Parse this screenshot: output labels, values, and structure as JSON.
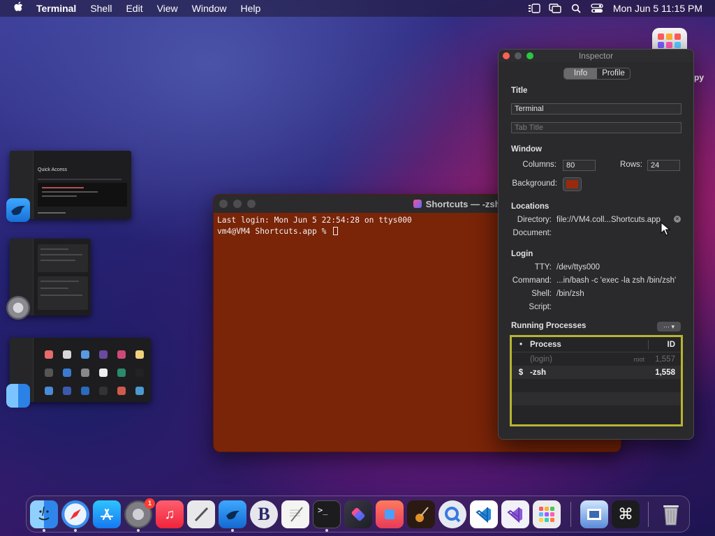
{
  "menubar": {
    "app_name": "Terminal",
    "menus": [
      "Shell",
      "Edit",
      "View",
      "Window",
      "Help"
    ],
    "clock": "Mon Jun 5  11:15 PM"
  },
  "stage_manager": {
    "thumb1_title": "Quick Access"
  },
  "desktop": {
    "partial_label": "py"
  },
  "terminal": {
    "title": "Shortcuts — -zsh — 80×24",
    "lines": [
      "Last login: Mon Jun  5 22:54:28 on ttys000",
      "vm4@VM4 Shortcuts.app % "
    ],
    "background_color": "#7a2408"
  },
  "inspector": {
    "window_title": "Inspector",
    "tabs": [
      "Info",
      "Profile"
    ],
    "active_tab": "Info",
    "title_section": {
      "heading": "Title",
      "title_value": "Terminal",
      "tab_title_placeholder": "Tab Title"
    },
    "window_section": {
      "heading": "Window",
      "columns_label": "Columns:",
      "columns_value": "80",
      "rows_label": "Rows:",
      "rows_value": "24",
      "background_label": "Background:",
      "background_color": "#9a2a0e"
    },
    "locations_section": {
      "heading": "Locations",
      "directory_label": "Directory:",
      "directory_value": "file://VM4.coll...Shortcuts.app",
      "document_label": "Document:"
    },
    "login_section": {
      "heading": "Login",
      "tty_label": "TTY:",
      "tty_value": "/dev/ttys000",
      "command_label": "Command:",
      "command_value": "...in/bash -c 'exec -la zsh /bin/zsh'",
      "shell_label": "Shell:",
      "shell_value": "/bin/zsh",
      "script_label": "Script:"
    },
    "processes_section": {
      "heading": "Running Processes",
      "columns": {
        "flag": "•",
        "process": "Process",
        "id": "ID"
      },
      "rows": [
        {
          "flag": "",
          "name": "(login)",
          "user": "root",
          "id": "1,557"
        },
        {
          "flag": "$",
          "name": "-zsh",
          "user": "",
          "id": "1,558"
        }
      ]
    }
  },
  "dock": {
    "apps": [
      "finder-icon",
      "safari-icon",
      "app-store-icon",
      "system-settings-icon",
      "music-icon",
      "script-editor-icon",
      "swift-icon",
      "bbedit-icon",
      "textedit-icon",
      "terminal-icon",
      "shortcuts-icon",
      "photo-booth-icon",
      "garageband-icon",
      "quicktime-icon",
      "vscode-icon",
      "visual-studio-icon",
      "launchpad-icon",
      "preview-icon",
      "keyboard-icon",
      "trash-icon"
    ],
    "settings_badge": "1"
  }
}
